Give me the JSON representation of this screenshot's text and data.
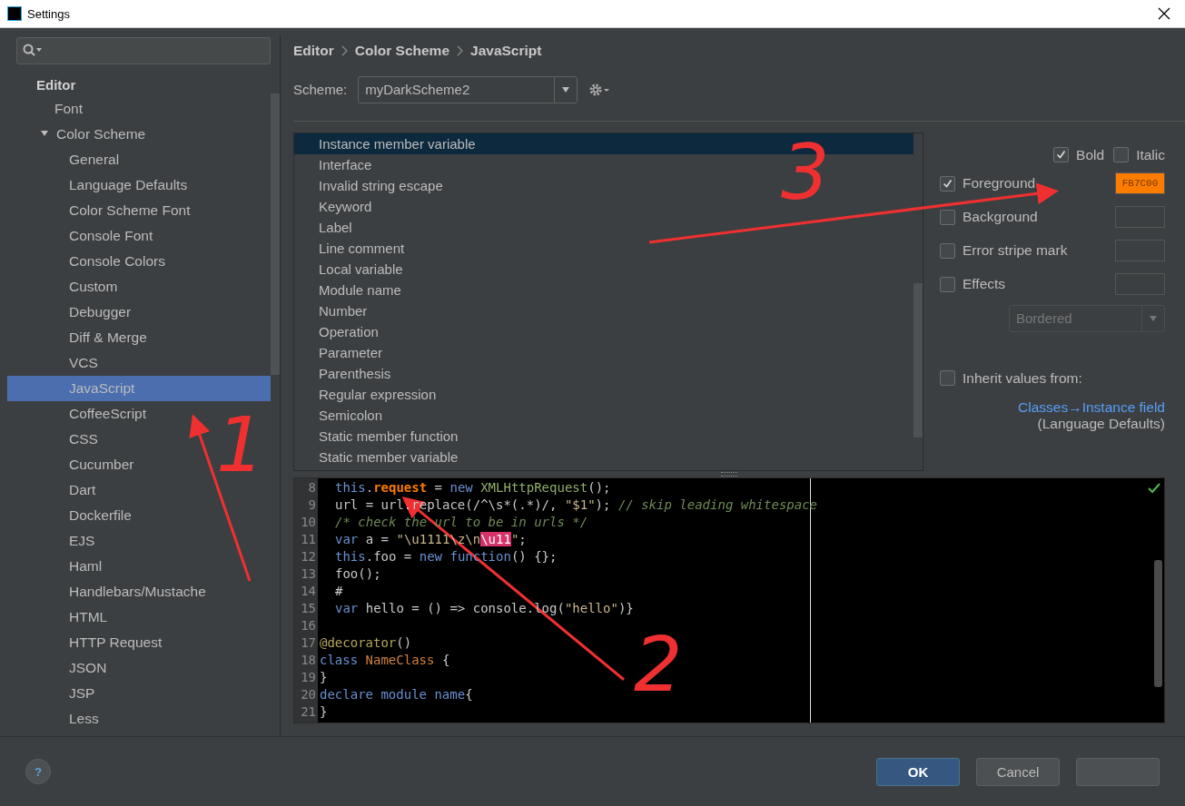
{
  "window": {
    "title": "Settings"
  },
  "sidebar": {
    "header": "Editor",
    "items": [
      {
        "label": "Font",
        "selected": false
      },
      {
        "label": "Color Scheme",
        "selected": false,
        "expanded": true,
        "children": [
          {
            "label": "General",
            "selected": false
          },
          {
            "label": "Language Defaults",
            "selected": false
          },
          {
            "label": "Color Scheme Font",
            "selected": false
          },
          {
            "label": "Console Font",
            "selected": false
          },
          {
            "label": "Console Colors",
            "selected": false
          },
          {
            "label": "Custom",
            "selected": false
          },
          {
            "label": "Debugger",
            "selected": false
          },
          {
            "label": "Diff & Merge",
            "selected": false
          },
          {
            "label": "VCS",
            "selected": false
          },
          {
            "label": "JavaScript",
            "selected": true
          },
          {
            "label": "CoffeeScript",
            "selected": false
          },
          {
            "label": "CSS",
            "selected": false
          },
          {
            "label": "Cucumber",
            "selected": false
          },
          {
            "label": "Dart",
            "selected": false
          },
          {
            "label": "Dockerfile",
            "selected": false
          },
          {
            "label": "EJS",
            "selected": false
          },
          {
            "label": "Haml",
            "selected": false
          },
          {
            "label": "Handlebars/Mustache",
            "selected": false
          },
          {
            "label": "HTML",
            "selected": false
          },
          {
            "label": "HTTP Request",
            "selected": false
          },
          {
            "label": "JSON",
            "selected": false
          },
          {
            "label": "JSP",
            "selected": false
          },
          {
            "label": "Less",
            "selected": false
          }
        ]
      }
    ]
  },
  "breadcrumb": [
    "Editor",
    "Color Scheme",
    "JavaScript"
  ],
  "scheme": {
    "label": "Scheme:",
    "value": "myDarkScheme2"
  },
  "attributes": [
    {
      "label": "Instance member variable",
      "selected": true
    },
    {
      "label": "Interface",
      "selected": false
    },
    {
      "label": "Invalid string escape",
      "selected": false
    },
    {
      "label": "Keyword",
      "selected": false
    },
    {
      "label": "Label",
      "selected": false
    },
    {
      "label": "Line comment",
      "selected": false
    },
    {
      "label": "Local variable",
      "selected": false
    },
    {
      "label": "Module name",
      "selected": false
    },
    {
      "label": "Number",
      "selected": false
    },
    {
      "label": "Operation",
      "selected": false
    },
    {
      "label": "Parameter",
      "selected": false
    },
    {
      "label": "Parenthesis",
      "selected": false
    },
    {
      "label": "Regular expression",
      "selected": false
    },
    {
      "label": "Semicolon",
      "selected": false
    },
    {
      "label": "Static member function",
      "selected": false
    },
    {
      "label": "Static member variable",
      "selected": false
    }
  ],
  "style_options": [
    {
      "label": "Bold",
      "checked": true
    },
    {
      "label": "Italic",
      "checked": false
    }
  ],
  "color_options": [
    {
      "label": "Foreground",
      "checked": true,
      "value": "FB7C00",
      "color": "#fb7c00"
    },
    {
      "label": "Background",
      "checked": false
    },
    {
      "label": "Error stripe mark",
      "checked": false
    },
    {
      "label": "Effects",
      "checked": false
    }
  ],
  "effect_type": {
    "value": "Bordered",
    "disabled": true
  },
  "inherit": {
    "label": "Inherit values from:",
    "checked": false,
    "link": "Classes→Instance field",
    "note": "(Language Defaults)"
  },
  "preview": [
    {
      "number": "8",
      "indented": true,
      "tokens": [
        {
          "kind": "keyword",
          "t": "this"
        },
        {
          "kind": "plain",
          "t": "."
        },
        {
          "kind": "field",
          "t": "request"
        },
        {
          "kind": "plain",
          "t": " = "
        },
        {
          "kind": "keyword",
          "t": "new"
        },
        {
          "kind": "type",
          "t": " XMLHttpRequest"
        },
        {
          "kind": "plain",
          "t": "();"
        }
      ]
    },
    {
      "number": "9",
      "indented": true,
      "tokens": [
        {
          "kind": "plain",
          "t": "url = url.replace(/^\\s*(.*)/, "
        },
        {
          "kind": "string",
          "t": "\"$1\""
        },
        {
          "kind": "plain",
          "t": "); "
        },
        {
          "kind": "comment",
          "t": "// skip leading whitespace"
        }
      ]
    },
    {
      "number": "10",
      "indented": true,
      "tokens": [
        {
          "kind": "comment",
          "t": "/* check the url to be in urls */"
        }
      ]
    },
    {
      "number": "11",
      "indented": true,
      "tokens": [
        {
          "kind": "keyword",
          "t": "var"
        },
        {
          "kind": "plain",
          "t": " a = "
        },
        {
          "kind": "string",
          "t": "\"\\u1111\\z\\n"
        },
        {
          "kind": "escape",
          "t": "\\u11"
        },
        {
          "kind": "string",
          "t": "\""
        },
        {
          "kind": "plain",
          "t": ";"
        }
      ]
    },
    {
      "number": "12",
      "indented": true,
      "tokens": [
        {
          "kind": "keyword",
          "t": "this"
        },
        {
          "kind": "plain",
          "t": ".foo = "
        },
        {
          "kind": "keyword",
          "t": "new function"
        },
        {
          "kind": "plain",
          "t": "() {};"
        }
      ]
    },
    {
      "number": "13",
      "indented": true,
      "tokens": [
        {
          "kind": "plain",
          "t": "foo();"
        }
      ]
    },
    {
      "number": "14",
      "indented": true,
      "tokens": [
        {
          "kind": "plain",
          "t": "#"
        }
      ]
    },
    {
      "number": "15",
      "indented": true,
      "tokens": [
        {
          "kind": "keyword",
          "t": "var"
        },
        {
          "kind": "plain",
          "t": " hello = () => console.log("
        },
        {
          "kind": "string",
          "t": "\"hello\""
        },
        {
          "kind": "plain",
          "t": ")}"
        }
      ]
    },
    {
      "number": "16"
    },
    {
      "number": "17",
      "indented": false,
      "tokens": [
        {
          "kind": "decorator",
          "t": "@decorator"
        },
        {
          "kind": "plain",
          "t": "()"
        }
      ]
    },
    {
      "number": "18",
      "indented": false,
      "tokens": [
        {
          "kind": "keyword",
          "t": "class"
        },
        {
          "kind": "classname",
          "t": " NameClass"
        },
        {
          "kind": "plain",
          "t": " {"
        }
      ]
    },
    {
      "number": "19",
      "indented": false,
      "tokens": [
        {
          "kind": "plain",
          "t": "}"
        }
      ]
    },
    {
      "number": "20",
      "indented": false,
      "tokens": [
        {
          "kind": "keyword",
          "t": "declare module name"
        },
        {
          "kind": "plain",
          "t": "{"
        }
      ]
    },
    {
      "number": "21",
      "indented": false,
      "tokens": [
        {
          "kind": "plain",
          "t": "}"
        }
      ]
    }
  ],
  "help": "?",
  "buttons": [
    {
      "label": "OK",
      "kind": "default"
    },
    {
      "label": "Cancel",
      "kind": "normal"
    },
    {
      "kind": "blank"
    }
  ],
  "annotations": [
    {
      "label": "1"
    },
    {
      "label": "2"
    },
    {
      "label": "3"
    }
  ]
}
